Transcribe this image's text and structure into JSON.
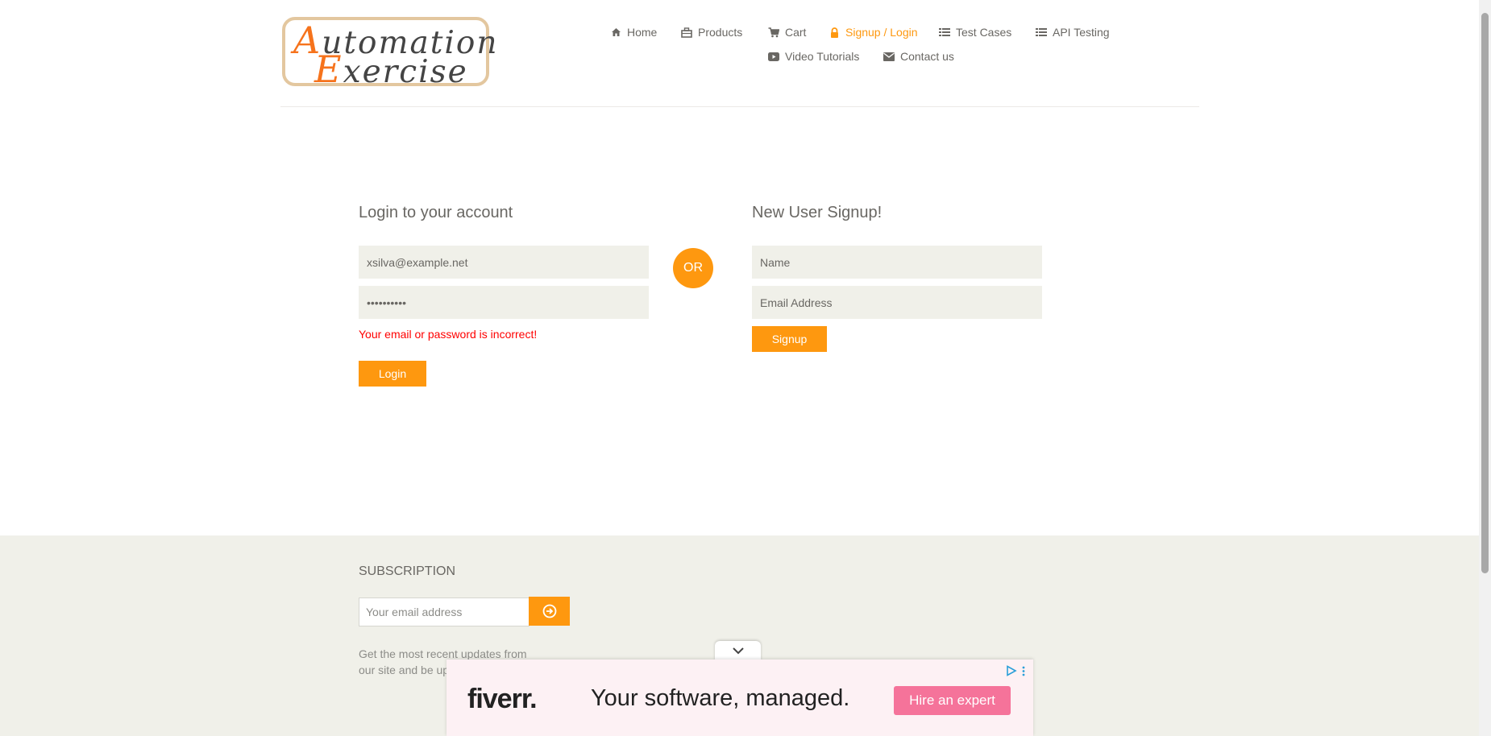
{
  "header": {
    "logo": {
      "line1_cap": "A",
      "line1_rest": "utomation",
      "line2_cap": "E",
      "line2_rest": "xercise"
    },
    "nav": [
      {
        "label": "Home",
        "icon": "home-icon"
      },
      {
        "label": "Products",
        "icon": "products-icon"
      },
      {
        "label": "Cart",
        "icon": "cart-icon"
      },
      {
        "label": "Signup / Login",
        "icon": "lock-icon",
        "active": true
      },
      {
        "label": "Test Cases",
        "icon": "list-icon"
      },
      {
        "label": "API Testing",
        "icon": "list-icon"
      },
      {
        "label": "Video Tutorials",
        "icon": "youtube-icon"
      },
      {
        "label": "Contact us",
        "icon": "envelope-icon"
      }
    ]
  },
  "login": {
    "title": "Login to your account",
    "email_value": "xsilva@example.net",
    "password_value": "••••••••••",
    "error": "Your email or password is incorrect!",
    "button": "Login"
  },
  "or_label": "OR",
  "signup": {
    "title": "New User Signup!",
    "name_placeholder": "Name",
    "email_placeholder": "Email Address",
    "button": "Signup"
  },
  "footer": {
    "subscription_title": "SUBSCRIPTION",
    "email_placeholder": "Your email address",
    "desc_line1": "Get the most recent updates from",
    "desc_line2": "our site and be up"
  },
  "ad": {
    "brand": "fiverr.",
    "headline": "Your software, managed.",
    "cta": "Hire an expert"
  },
  "colors": {
    "accent": "#fe980f",
    "error": "#ff0000",
    "footer_bg": "#f0f0e9",
    "ad_cta": "#f5739a"
  }
}
